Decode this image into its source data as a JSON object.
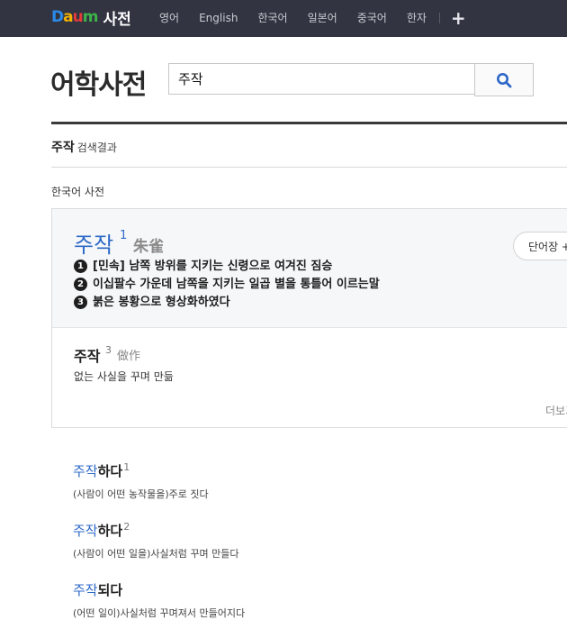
{
  "nav": {
    "logo_text": "Daum",
    "logo_dict": "사전",
    "items": [
      "영어",
      "English",
      "한국어",
      "일본어",
      "중국어",
      "한자"
    ],
    "plus": "+"
  },
  "header": {
    "title": "어학사전",
    "search_value": "주작"
  },
  "results": {
    "query": "주작",
    "label": "검색결과",
    "section": "한국어 사전"
  },
  "entry1": {
    "word": "주작",
    "sup": "1",
    "hanja": "朱雀",
    "button": "단어장 +",
    "defs": [
      {
        "num": "1",
        "text": "[민속] 남쪽 방위를 지키는 신령으로 여겨진 짐승"
      },
      {
        "num": "2",
        "text": "이십팔수 가운데 남쪽을 지키는 일곱 별을 통틀어 이르는말"
      },
      {
        "num": "3",
        "text": "붉은 봉황으로 형상화하였다"
      }
    ]
  },
  "entry3": {
    "word": "주작",
    "sup": "3",
    "hanja": "做作",
    "def": "없는 사실을 꾸며 만듦",
    "more": "더보기"
  },
  "related": [
    {
      "hl": "주작",
      "rest": "하다",
      "sup": "1",
      "def": "(사람이 어떤 농작물을)주로 짓다"
    },
    {
      "hl": "주작",
      "rest": "하다",
      "sup": "2",
      "def": "(사람이 어떤 일을)사실처럼 꾸며 만들다"
    },
    {
      "hl": "주작",
      "rest": "되다",
      "sup": "",
      "def": "(어떤 일이)사실처럼 꾸며져서 만들어지다"
    }
  ]
}
